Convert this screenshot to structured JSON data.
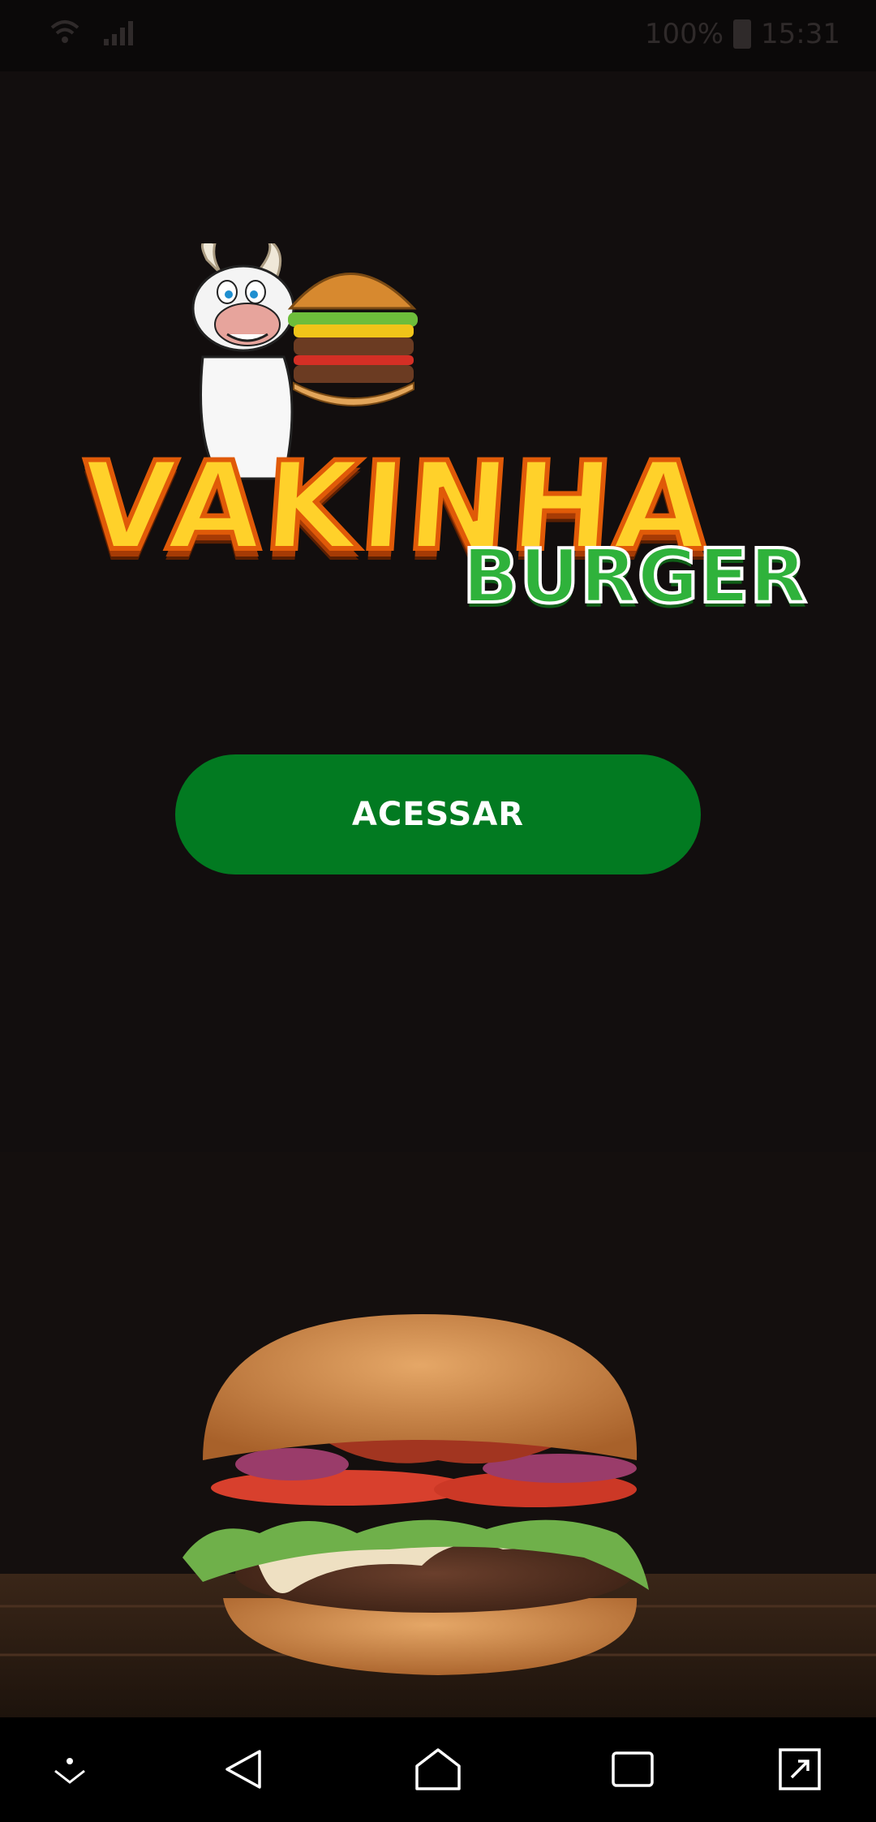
{
  "status_bar": {
    "battery_text": "100%",
    "time": "15:31",
    "icons": [
      "wifi-icon",
      "signal-icon",
      "battery-icon"
    ]
  },
  "logo": {
    "main_text": "VAKINHA",
    "sub_text": "BURGER"
  },
  "main": {
    "cta_label": "ACESSAR"
  },
  "nav_bar": {
    "icons": [
      "hide-nav-icon",
      "back-icon",
      "home-icon",
      "recents-icon",
      "screen-toggle-icon"
    ]
  },
  "colors": {
    "background": "#120e0e",
    "button": "#027a21",
    "button_text": "#ffffff",
    "logo_yellow": "#ffd12a",
    "logo_green": "#2fb23b"
  }
}
